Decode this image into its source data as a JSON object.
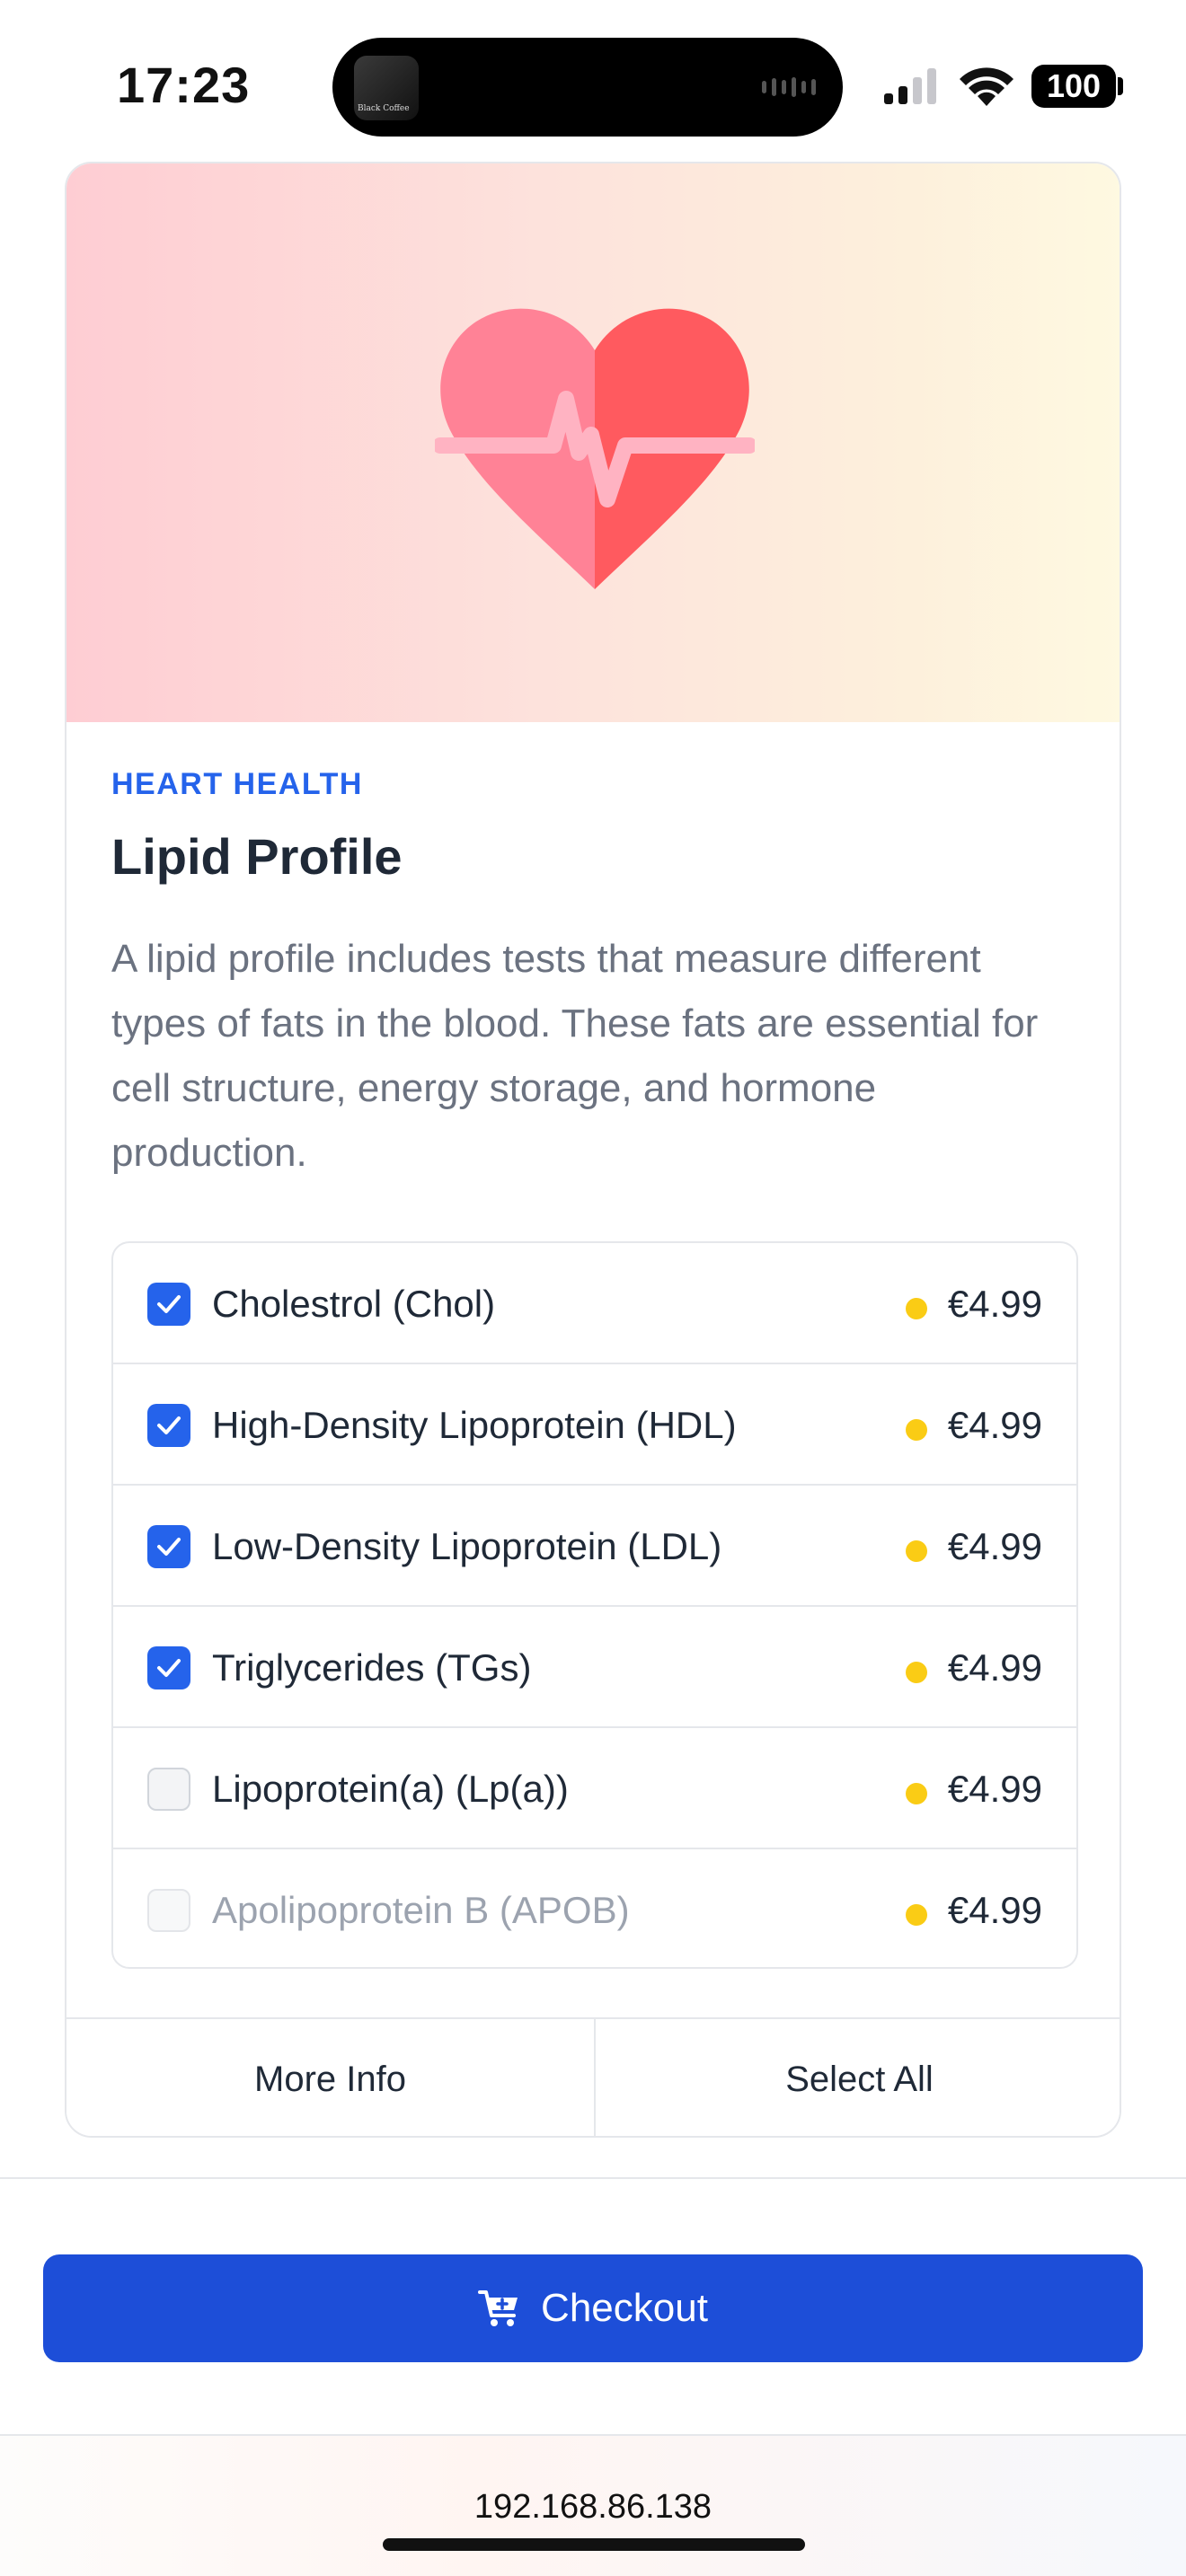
{
  "status_bar": {
    "time": "17:23",
    "album_label": "Black Coffee",
    "battery": "100"
  },
  "card": {
    "category": "HEART HEALTH",
    "title": "Lipid Profile",
    "description": "A lipid profile includes tests that measure different types of fats in the blood. These fats are essential for cell structure, energy storage, and hormone production.",
    "hero_icon": "heart-pulse-icon",
    "tests": [
      {
        "name": "Cholestrol (Chol)",
        "price": "€4.99",
        "checked": true
      },
      {
        "name": "High-Density Lipoprotein (HDL)",
        "price": "€4.99",
        "checked": true
      },
      {
        "name": "Low-Density Lipoprotein (LDL)",
        "price": "€4.99",
        "checked": true
      },
      {
        "name": "Triglycerides (TGs)",
        "price": "€4.99",
        "checked": true
      },
      {
        "name": "Lipoprotein(a) (Lp(a))",
        "price": "€4.99",
        "checked": false
      },
      {
        "name": "Apolipoprotein B (APOB)",
        "price": "€4.99",
        "checked": false
      }
    ],
    "more_info_label": "More Info",
    "select_all_label": "Select All"
  },
  "checkout": {
    "label": "Checkout",
    "icon": "cart-icon"
  },
  "browser": {
    "address": "192.168.86.138"
  },
  "colors": {
    "accent": "#2563eb",
    "checkout": "#1d4ed8",
    "price_dot": "#facc15"
  }
}
